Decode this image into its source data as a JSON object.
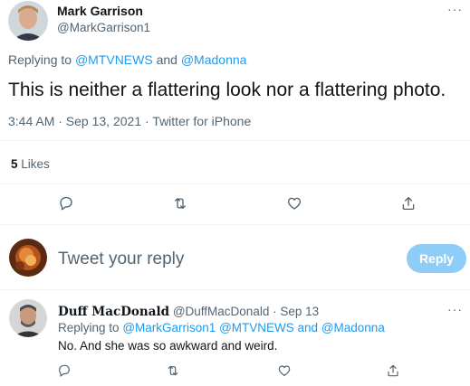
{
  "main_tweet": {
    "author_name": "Mark Garrison",
    "author_handle": "@MarkGarrison1",
    "replying_label": "Replying to",
    "reply_to_1": "@MTVNEWS",
    "and_word": "and",
    "reply_to_2": "@Madonna",
    "text": "This is neither a flattering look nor a flattering photo.",
    "timestamp": "3:44 AM · Sep 13, 2021 · Twitter for iPhone",
    "likes_count": "5",
    "likes_label": "Likes"
  },
  "compose": {
    "placeholder": "Tweet your reply",
    "reply_button": "Reply"
  },
  "reply_tweet": {
    "author_name": "Duff MacDonald",
    "author_handle": "@DuffMacDonald",
    "separator": "·",
    "date": "Sep 13",
    "replying_label": "Replying to",
    "reply_to_1": "@MarkGarrison1",
    "reply_to_2": "@MTVNEWS",
    "and_word": "and",
    "reply_to_3": "@Madonna",
    "text": "No. And she was so awkward and weird."
  },
  "more_glyph": "···",
  "icons": [
    "reply-icon",
    "retweet-icon",
    "like-icon",
    "share-icon"
  ],
  "colors": {
    "accent": "#1d9bf0",
    "reply_button_disabled": "#8ecdf8",
    "muted": "#536471",
    "divider": "#eff3f4"
  }
}
